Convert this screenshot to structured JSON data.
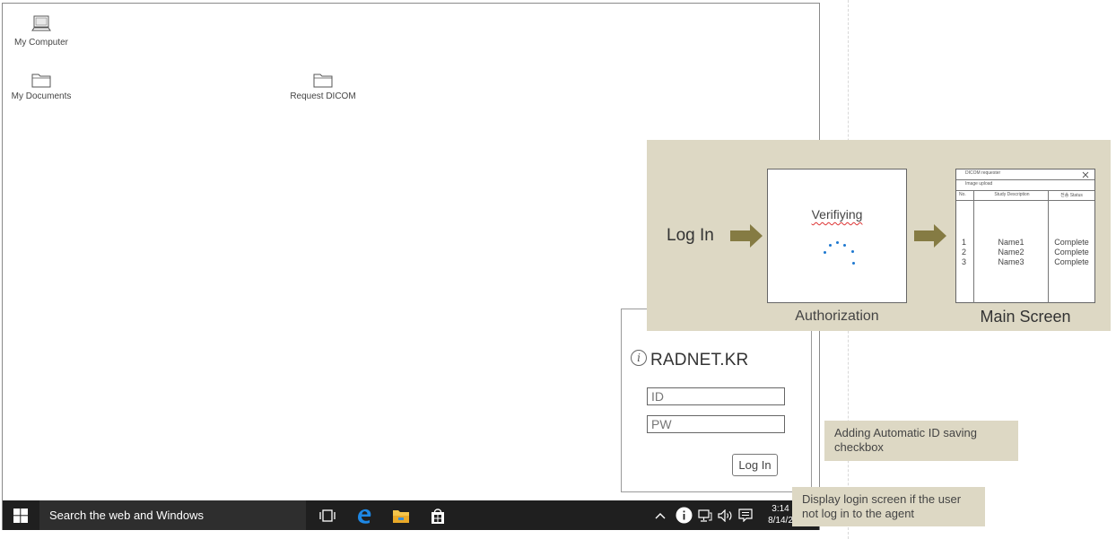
{
  "desktop": {
    "icons": [
      {
        "label": "My Computer",
        "icon": "computer-icon"
      },
      {
        "label": "My Documents",
        "icon": "folder-icon"
      },
      {
        "label": "Request DICOM",
        "icon": "folder-icon"
      }
    ]
  },
  "taskbar": {
    "search_text": "Search the  web and Windows",
    "clock_time": "3:14",
    "clock_date": "8/14/2"
  },
  "login_panel": {
    "brand": "RADNET.KR",
    "id_placeholder": "ID",
    "pw_placeholder": "PW",
    "login_button": "Log In"
  },
  "flow": {
    "start_label": "Log In",
    "auth_text": "Verifiying",
    "auth_label": "Authorization",
    "main_label": "Main Screen",
    "main_screen": {
      "title": "DICOM requester",
      "subtitle": "Image upload",
      "columns": [
        "No.",
        "Study Description",
        "전송 Status"
      ],
      "rows": [
        {
          "no": "1",
          "name": "Name1",
          "status": "Complete"
        },
        {
          "no": "2",
          "name": "Name2",
          "status": "Complete"
        },
        {
          "no": "3",
          "name": "Name3",
          "status": "Complete"
        }
      ]
    }
  },
  "notes": {
    "auto_id": "Adding Automatic ID saving checkbox",
    "display_login": "Display login screen  if the user not log  in to the agent"
  },
  "colors": {
    "flow_bg": "#ddd8c4",
    "arrow": "#857b43",
    "taskbar": "#1f1f1f",
    "spinner": "#1e78d0"
  }
}
